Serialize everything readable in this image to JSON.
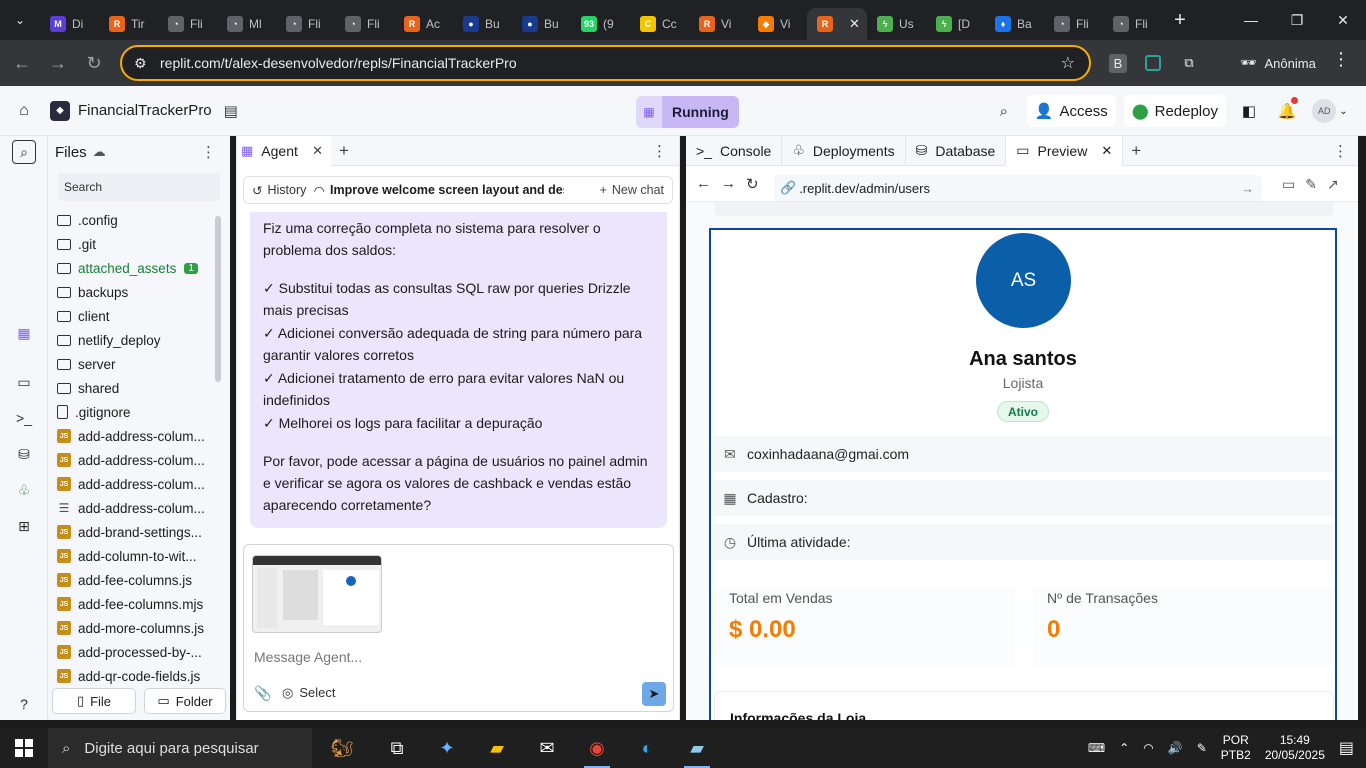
{
  "browser": {
    "tabs": [
      {
        "label": "Di",
        "color": "#5b3fd6",
        "glyph": "M"
      },
      {
        "label": "Tir",
        "color": "#e8641b",
        "glyph": "R"
      },
      {
        "label": "Fli",
        "color": "#5f6368",
        "glyph": "◔"
      },
      {
        "label": "Ml",
        "color": "#5f6368",
        "glyph": "◔"
      },
      {
        "label": "Fli",
        "color": "#5f6368",
        "glyph": "◔"
      },
      {
        "label": "Fli",
        "color": "#5f6368",
        "glyph": "◔"
      },
      {
        "label": "Ac",
        "color": "#e8641b",
        "glyph": "R"
      },
      {
        "label": "Bu",
        "color": "#1a3a8f",
        "glyph": "●"
      },
      {
        "label": "Bu",
        "color": "#1a3a8f",
        "glyph": "●"
      },
      {
        "label": "(9",
        "color": "#25d366",
        "glyph": "93"
      },
      {
        "label": "Cc",
        "color": "#f5c400",
        "glyph": "C"
      },
      {
        "label": "Vi",
        "color": "#e8641b",
        "glyph": "R"
      },
      {
        "label": "Vi",
        "color": "#f57c00",
        "glyph": "◆"
      },
      {
        "label": "",
        "color": "#e8641b",
        "glyph": "R",
        "active": true
      },
      {
        "label": "Us",
        "color": "#4caf50",
        "glyph": "ϟ"
      },
      {
        "label": "[D",
        "color": "#4caf50",
        "glyph": "ϟ"
      },
      {
        "label": "Ba",
        "color": "#1a73e8",
        "glyph": "♦"
      },
      {
        "label": "Fli",
        "color": "#5f6368",
        "glyph": "◔"
      },
      {
        "label": "Fli",
        "color": "#5f6368",
        "glyph": "◔"
      }
    ],
    "url": "replit.com/t/alex-desenvolvedor/repls/FinancialTrackerPro",
    "profile_label": "Anônima",
    "ext_b_label": "B"
  },
  "replit": {
    "project_name": "FinancialTrackerPro",
    "status_label": "Running",
    "access_label": "Access",
    "redeploy_label": "Redeploy",
    "avatar_initials": "AD"
  },
  "files": {
    "title": "Files",
    "search_placeholder": "Search",
    "items": [
      {
        "name": ".config",
        "type": "folder"
      },
      {
        "name": ".git",
        "type": "folder"
      },
      {
        "name": "attached_assets",
        "type": "folder",
        "badge": "1",
        "highlight": true
      },
      {
        "name": "backups",
        "type": "folder"
      },
      {
        "name": "client",
        "type": "folder"
      },
      {
        "name": "netlify_deploy",
        "type": "folder"
      },
      {
        "name": "server",
        "type": "folder"
      },
      {
        "name": "shared",
        "type": "folder"
      },
      {
        "name": ".gitignore",
        "type": "doc"
      },
      {
        "name": "add-address-colum...",
        "type": "js"
      },
      {
        "name": "add-address-colum...",
        "type": "js"
      },
      {
        "name": "add-address-colum...",
        "type": "js"
      },
      {
        "name": "add-address-colum...",
        "type": "db"
      },
      {
        "name": "add-brand-settings...",
        "type": "js"
      },
      {
        "name": "add-column-to-wit...",
        "type": "js"
      },
      {
        "name": "add-fee-columns.js",
        "type": "js"
      },
      {
        "name": "add-fee-columns.mjs",
        "type": "js"
      },
      {
        "name": "add-more-columns.js",
        "type": "js"
      },
      {
        "name": "add-processed-by-...",
        "type": "js"
      },
      {
        "name": "add-qr-code-fields.js",
        "type": "js"
      }
    ],
    "file_button": "File",
    "folder_button": "Folder"
  },
  "agent": {
    "tab_label": "Agent",
    "history_label": "History",
    "conversation_title": "Improve welcome screen layout and desig...",
    "new_chat_label": "New chat",
    "message": {
      "intro": "Fiz uma correção completa no sistema para resolver o problema dos saldos:",
      "checks": [
        "✓ Substitui todas as consultas SQL raw por queries Drizzle mais precisas",
        "✓ Adicionei conversão adequada de string para número para garantir valores corretos",
        "✓ Adicionei tratamento de erro para evitar valores NaN ou indefinidos",
        "✓ Melhorei os logs para facilitar a depuração"
      ],
      "closing": "Por favor, pode acessar a página de usuários no painel admin e verificar se agora os valores de cashback e vendas estão aparecendo corretamente?"
    },
    "input_placeholder": "Message Agent...",
    "select_label": "Select"
  },
  "right_pane": {
    "tabs": [
      "Console",
      "Deployments",
      "Database",
      "Preview"
    ],
    "preview_url_prefix": ".replit.dev",
    "preview_url_path": "/admin/users"
  },
  "user_card": {
    "initials": "AS",
    "name": "Ana santos",
    "role": "Lojista",
    "status": "Ativo",
    "email": "coxinhadaana@gmai.com",
    "registered_label": "Cadastro:",
    "last_activity_label": "Última atividade:",
    "total_sales_label": "Total em Vendas",
    "total_sales_value": "$ 0.00",
    "transactions_label": "Nº de Transações",
    "transactions_value": "0",
    "store_info_title": "Informações da Loja"
  },
  "taskbar": {
    "search_placeholder": "Digite aqui para pesquisar",
    "lang_top": "POR",
    "lang_bottom": "PTB2",
    "time": "15:49",
    "date": "20/05/2025"
  }
}
